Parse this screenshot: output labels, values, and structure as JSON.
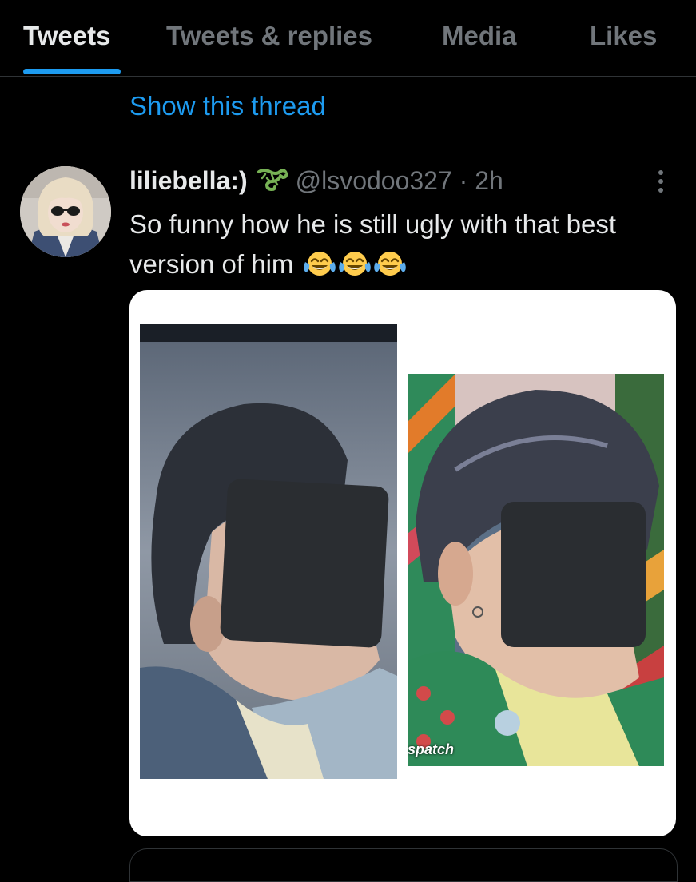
{
  "tabs": [
    {
      "label": "Tweets",
      "active": true
    },
    {
      "label": "Tweets & replies",
      "active": false
    },
    {
      "label": "Media",
      "active": false
    },
    {
      "label": "Likes",
      "active": false
    }
  ],
  "thread": {
    "show_label": "Show this thread"
  },
  "tweet": {
    "display_name": "liliebella:)",
    "name_emoji": "lizard-icon",
    "handle": "@lsvodoo327",
    "separator": "·",
    "time": "2h",
    "text": "So funny how he is still ugly with that best version of him",
    "text_emoji": [
      "face-with-tears-of-joy-icon",
      "face-with-tears-of-joy-icon",
      "face-with-tears-of-joy-icon"
    ],
    "media_watermark": "spatch"
  },
  "colors": {
    "background": "#000000",
    "accent": "#1d9bf0",
    "primary_text": "#e7e9ea",
    "secondary_text": "#71767b",
    "divider": "#2f3336"
  }
}
